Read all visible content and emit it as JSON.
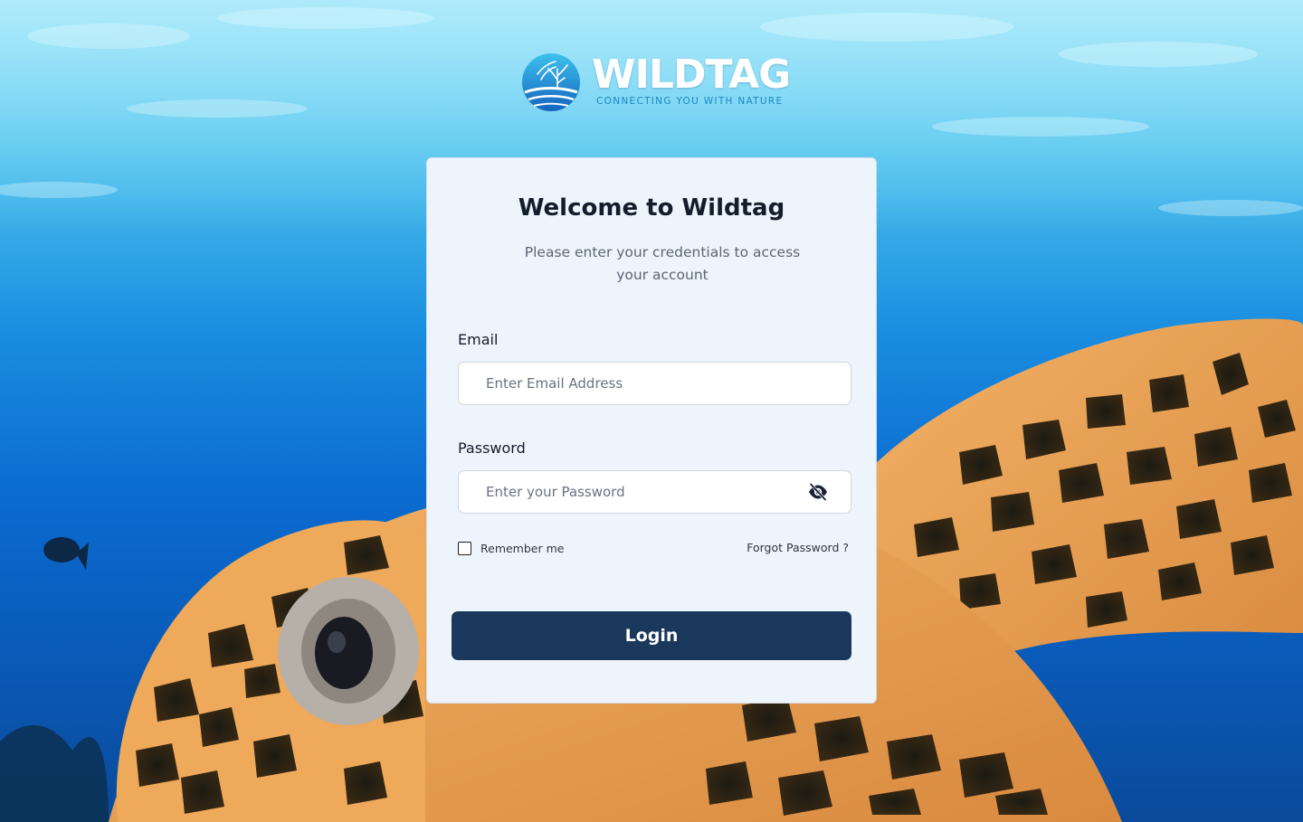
{
  "brand": {
    "name": "WILDTAG",
    "tagline": "CONNECTING YOU WITH NATURE",
    "logo_icon": "coral-wave-globe-icon"
  },
  "login_card": {
    "title": "Welcome to Wildtag",
    "subtitle": "Please enter your credentials to access your account",
    "email": {
      "label": "Email",
      "placeholder": "Enter Email Address",
      "value": ""
    },
    "password": {
      "label": "Password",
      "placeholder": "Enter your Password",
      "value": "",
      "toggle_icon": "eye-off-icon"
    },
    "remember_me": {
      "label": "Remember me",
      "checked": false
    },
    "forgot_password_label": "Forgot Password ?",
    "login_button_label": "Login"
  },
  "colors": {
    "primary_button": "#1a375c",
    "card_background": "#eef4fb",
    "brand_accent": "#1d87c6"
  },
  "background_image": "sea-turtle-underwater"
}
